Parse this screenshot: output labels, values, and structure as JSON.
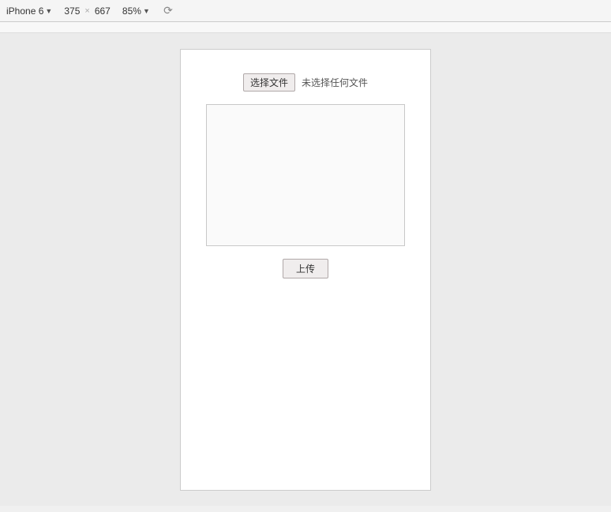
{
  "toolbar": {
    "device_name": "iPhone 6",
    "dropdown_arrow": "▼",
    "separator": "×",
    "width": "375",
    "height": "667",
    "zoom": "85%",
    "zoom_arrow": "▼",
    "refresh_icon": "⟳"
  },
  "device": {
    "file_choose_btn_label": "选择文件",
    "file_no_selected_label": "未选择任何文件",
    "upload_btn_label": "上传"
  }
}
